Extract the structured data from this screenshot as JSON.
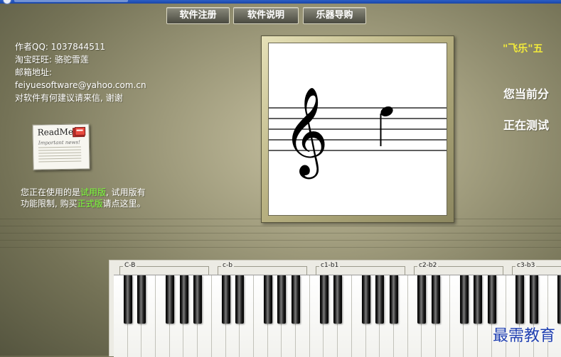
{
  "toolbar": {
    "buttons": [
      {
        "label": "软件注册"
      },
      {
        "label": "软件说明"
      },
      {
        "label": "乐器导购"
      }
    ]
  },
  "info": {
    "lines": [
      "作者QQ: 1037844511",
      "淘宝旺旺: 骆驼雪莲",
      "邮箱地址:",
      "feiyuesoftware@yahoo.com.cn",
      "对软件有何建议请来信, 谢谢"
    ]
  },
  "readme": {
    "title": "ReadMe",
    "subtitle": "Important news!"
  },
  "trial": {
    "text_1": "您正在使用的是",
    "highlight_1": "试用版",
    "text_2": ", 试用版有功能限制, 购买",
    "highlight_2": "正式版",
    "text_3": "请点这里。"
  },
  "right_panel": {
    "title": "\"飞乐\"五",
    "score_label": "您当前分",
    "status": "正在测试"
  },
  "keyboard": {
    "octaves": [
      "C-B",
      "c-b",
      "c1-b1",
      "c2-b2",
      "c3-b3"
    ]
  },
  "watermark": "最需教育",
  "colors": {
    "highlight": "#7CFF3A",
    "title_yellow": "#f2ea3a"
  }
}
